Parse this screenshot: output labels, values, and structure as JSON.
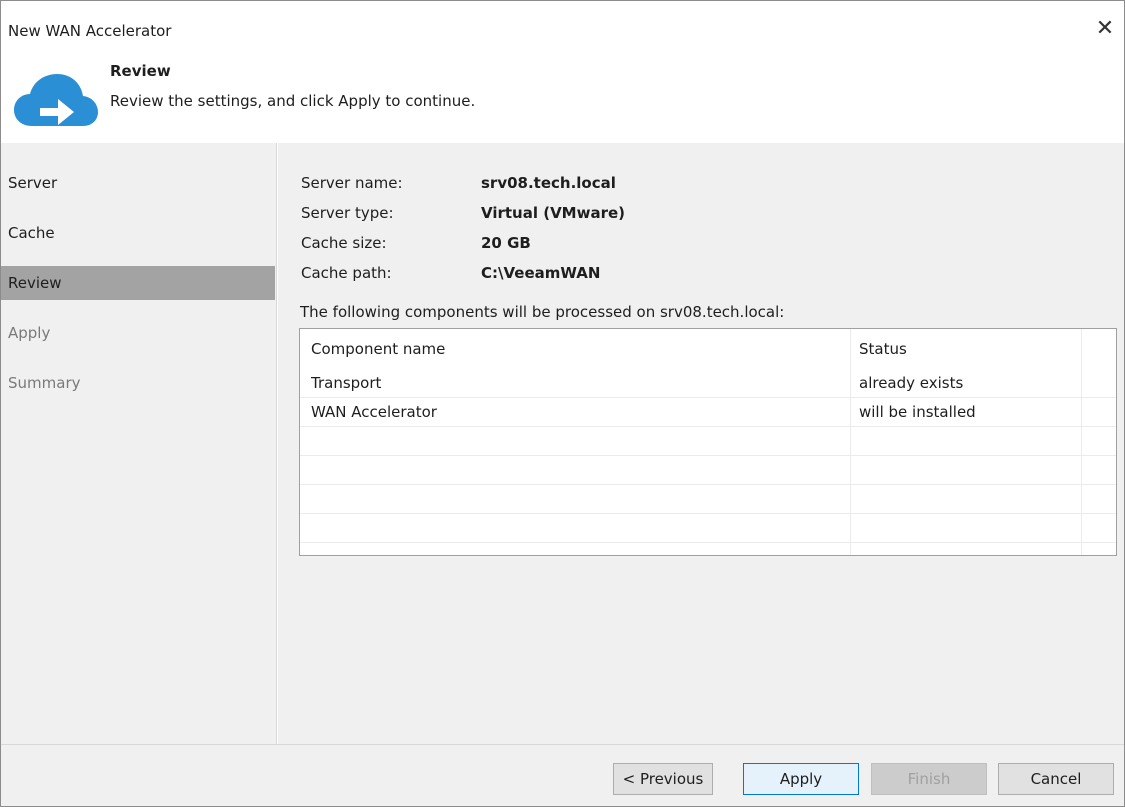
{
  "window": {
    "title": "New WAN Accelerator",
    "close_glyph": "✕"
  },
  "header": {
    "icon": "cloud-arrow-icon",
    "title": "Review",
    "subtitle": "Review the settings, and click Apply to continue."
  },
  "sidebar": {
    "items": [
      {
        "label": "Server",
        "state": "normal"
      },
      {
        "label": "Cache",
        "state": "normal"
      },
      {
        "label": "Review",
        "state": "active"
      },
      {
        "label": "Apply",
        "state": "disabled"
      },
      {
        "label": "Summary",
        "state": "disabled"
      }
    ]
  },
  "review": {
    "fields": [
      {
        "label": "Server name:",
        "value": "srv08.tech.local"
      },
      {
        "label": "Server type:",
        "value": "Virtual (VMware)"
      },
      {
        "label": "Cache size:",
        "value": "20 GB"
      },
      {
        "label": "Cache path:",
        "value": "C:\\VeeamWAN"
      }
    ],
    "components_caption": "The following components will be processed on srv08.tech.local:",
    "table": {
      "columns": [
        "Component name",
        "Status"
      ],
      "rows": [
        {
          "name": "Transport",
          "status": "already exists"
        },
        {
          "name": "WAN Accelerator",
          "status": "will be installed"
        }
      ]
    }
  },
  "footer": {
    "previous_label": "< Previous",
    "apply_label": "Apply",
    "finish_label": "Finish",
    "cancel_label": "Cancel"
  },
  "colors": {
    "accent": "#0078d7",
    "icon_blue": "#2b8fd6",
    "sidebar_active": "#a3a3a3"
  }
}
